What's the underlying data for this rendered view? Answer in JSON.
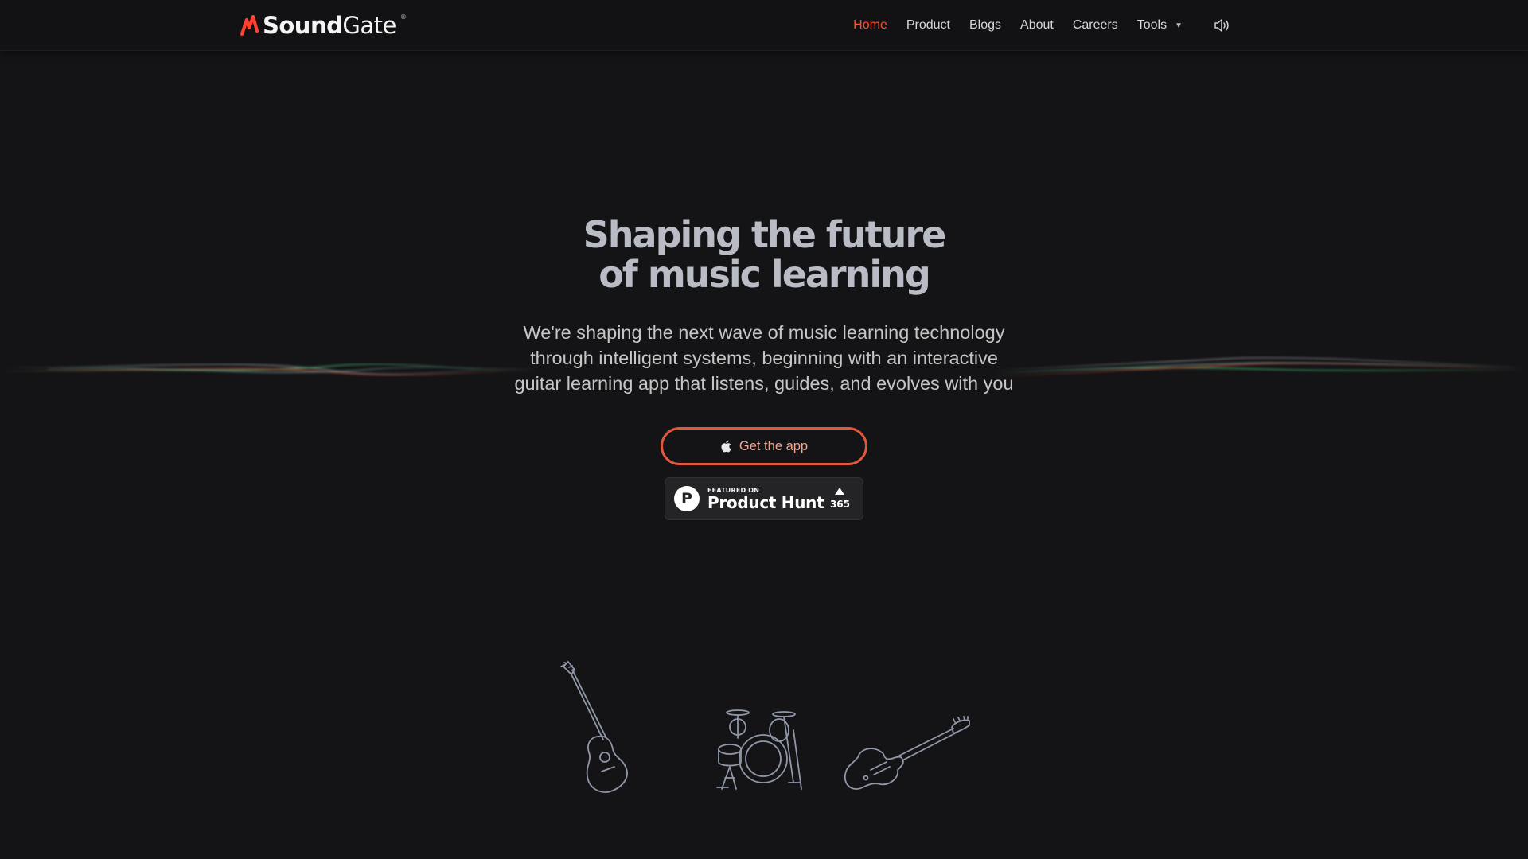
{
  "brand": {
    "name_bold": "Sound",
    "name_light": "Gate",
    "registered": "®"
  },
  "nav": {
    "items": [
      {
        "label": "Home",
        "active": true
      },
      {
        "label": "Product",
        "active": false
      },
      {
        "label": "Blogs",
        "active": false
      },
      {
        "label": "About",
        "active": false
      },
      {
        "label": "Careers",
        "active": false
      },
      {
        "label": "Tools",
        "active": false
      }
    ],
    "tools_caret_icon": "caret-down-icon",
    "sound_toggle_icon": "speaker-icon"
  },
  "hero": {
    "title_line1": "Shaping the future",
    "title_line2": "of music learning",
    "subtitle_line1": "We're shaping the next wave of music learning technology",
    "subtitle_line2": "through intelligent systems, beginning with an interactive",
    "subtitle_line3": "guitar learning app that listens, guides, and evolves with you"
  },
  "cta": {
    "label": "Get the app",
    "icon": "apple-icon"
  },
  "product_hunt": {
    "featured_label": "FEATURED ON",
    "name": "Product Hunt",
    "logo_letter": "P",
    "upvotes": "365"
  },
  "instruments": [
    {
      "icon": "acoustic-guitar-icon"
    },
    {
      "icon": "drum-kit-icon"
    },
    {
      "icon": "electric-guitar-icon"
    }
  ],
  "colors": {
    "background": "#141416",
    "accent": "#ff4d30",
    "cta_border": "#e3583c",
    "title": "#b9bcc4",
    "instrument_outline": "#8f97a8"
  }
}
